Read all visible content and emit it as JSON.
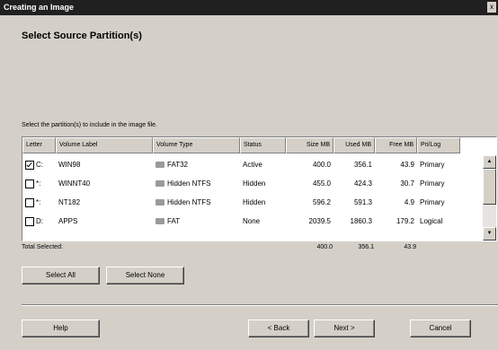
{
  "window": {
    "title": "Creating an Image",
    "close_glyph": "x"
  },
  "page": {
    "heading": "Select Source Partition(s)",
    "instruction": "Select the partition(s) to include in the image file."
  },
  "table": {
    "columns": [
      "Letter",
      "Volume Label",
      "Volume Type",
      "Status",
      "Size MB",
      "Used MB",
      "Free MB",
      "Pri/Log"
    ],
    "rows": [
      {
        "checked": true,
        "letter": "C:",
        "label": "WIN98",
        "type": "FAT32",
        "status": "Active",
        "size": "400.0",
        "used": "356.1",
        "free": "43.9",
        "prilog": "Primary",
        "icon": "drive-icon"
      },
      {
        "checked": false,
        "letter": "*:",
        "label": "WINNT40",
        "type": "Hidden NTFS",
        "status": "Hidden",
        "size": "455.0",
        "used": "424.3",
        "free": "30.7",
        "prilog": "Primary",
        "icon": "drive-icon"
      },
      {
        "checked": false,
        "letter": "*:",
        "label": "NT182",
        "type": "Hidden NTFS",
        "status": "Hidden",
        "size": "596.2",
        "used": "591.3",
        "free": "4.9",
        "prilog": "Primary",
        "icon": "drive-icon"
      },
      {
        "checked": false,
        "letter": "D:",
        "label": "APPS",
        "type": "FAT",
        "status": "None",
        "size": "2039.5",
        "used": "1860.3",
        "free": "179.2",
        "prilog": "Logical",
        "icon": "drive-icon"
      }
    ],
    "totals": {
      "label": "Total Selected:",
      "size": "400.0",
      "used": "356.1",
      "free": "43.9"
    },
    "scroll": {
      "up": "▲",
      "down": "▼"
    }
  },
  "buttons": {
    "select_all": "Select All",
    "select_none": "Select None",
    "help": "Help",
    "back": "< Back",
    "next": "Next >",
    "cancel": "Cancel"
  }
}
